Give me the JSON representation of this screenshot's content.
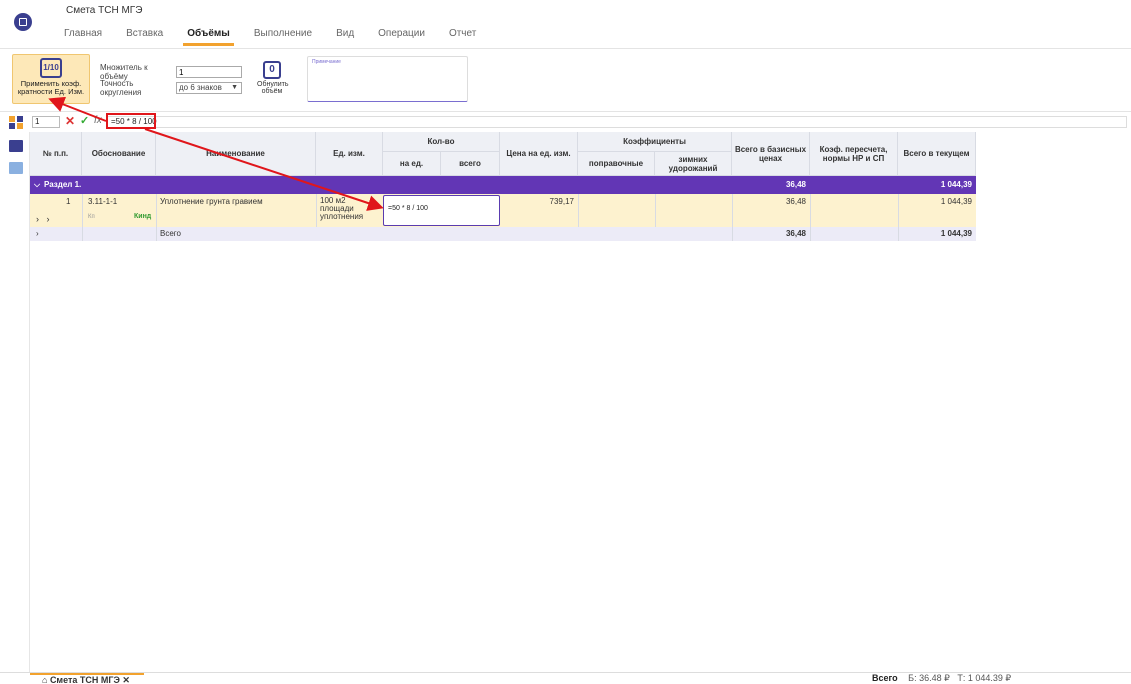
{
  "app": {
    "title": "Смета ТСН МГЭ"
  },
  "tabs": [
    "Главная",
    "Вставка",
    "Объёмы",
    "Выполнение",
    "Вид",
    "Операции",
    "Отчет"
  ],
  "active_tab": "Объёмы",
  "ribbon": {
    "apply_icon": "1/10",
    "apply_label": "Применить коэф. кратности Ед. Изм.",
    "multiplier_label": "Множитель к объёму",
    "multiplier_value": "1",
    "rounding_label": "Точность округления",
    "rounding_value": "до 6 знаков",
    "reset_icon": "0",
    "reset_label": "Обнулить объём",
    "note_label": "Примечание"
  },
  "formula_bar": {
    "cell": "1",
    "formula": "=50 * 8 / 100"
  },
  "table": {
    "headers": {
      "num": "№ п.п.",
      "basis": "Обоснование",
      "name": "Наименование",
      "unit": "Ед. изм.",
      "qty": "Кол-во",
      "qty_per": "на ед.",
      "qty_total": "всего",
      "price": "Цена на ед. изм.",
      "coef": "Коэффициенты",
      "coef_corr": "поправочные",
      "coef_winter": "зимних удорожаний",
      "base_total": "Всего в базисных ценах",
      "recalc": "Коэф. пересчета, нормы НР и СП",
      "cur_total": "Всего в текущем"
    },
    "section": {
      "label": "Раздел 1.",
      "base_total": "36,48",
      "cur_total": "1 044,39"
    },
    "item": {
      "num": "1",
      "code": "3.11-1-1",
      "name": "Уплотнение грунта гравием",
      "unit": "100 м2 площади уплотнения",
      "kn": "Кп",
      "kind": "Кинд",
      "price": "739,17",
      "base_total": "36,48",
      "cur_total": "1 044,39",
      "editor_value": "=50 * 8 / 100"
    },
    "total": {
      "label": "Всего",
      "base_total": "36,48",
      "cur_total": "1 044,39"
    }
  },
  "bottom": {
    "doc_tab": "Смета ТСН МГЭ",
    "status_label": "Всего",
    "status_base": "Б: 36.48 ₽",
    "status_cur": "Т: 1 044.39 ₽"
  },
  "colors": {
    "accent": "#f2a22e",
    "section": "#6236b5",
    "arrow": "#e0161b",
    "row_highlight": "#fdf2cf"
  }
}
